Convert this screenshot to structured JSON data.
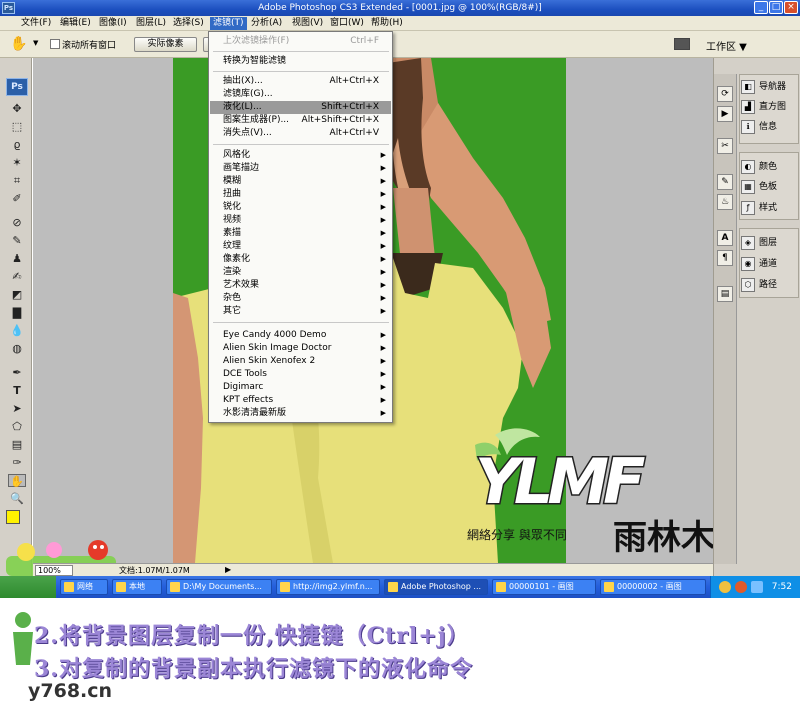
{
  "window": {
    "app_badge": "Ps",
    "title": "Adobe Photoshop CS3 Extended - [0001.jpg @ 100%(RGB/8#)]",
    "buttons": [
      "_",
      "□",
      "×"
    ]
  },
  "menubar": {
    "items": [
      "文件(F)",
      "编辑(E)",
      "图像(I)",
      "图层(L)",
      "选择(S)",
      "滤镜(T)",
      "分析(A)",
      "视图(V)",
      "窗口(W)",
      "帮助(H)"
    ],
    "active_index": 5
  },
  "options_bar": {
    "scroll_all_label": "滚动所有窗口",
    "actual_pixels_label": "实际像素",
    "workspace_label": "工作区 ▼"
  },
  "filter_menu": {
    "items": [
      {
        "label": "上次滤镜操作(F)",
        "shortcut": "Ctrl+F",
        "disabled": true
      },
      {
        "separator": true
      },
      {
        "label": "转换为智能滤镜"
      },
      {
        "separator": true
      },
      {
        "label": "抽出(X)...",
        "shortcut": "Alt+Ctrl+X"
      },
      {
        "label": "滤镜库(G)..."
      },
      {
        "label": "液化(L)...",
        "shortcut": "Shift+Ctrl+X",
        "highlighted": true
      },
      {
        "label": "图案生成器(P)...",
        "shortcut": "Alt+Shift+Ctrl+X"
      },
      {
        "label": "消失点(V)...",
        "shortcut": "Alt+Ctrl+V"
      },
      {
        "separator": true
      },
      {
        "label": "风格化",
        "submenu": true
      },
      {
        "label": "画笔描边",
        "submenu": true
      },
      {
        "label": "模糊",
        "submenu": true
      },
      {
        "label": "扭曲",
        "submenu": true
      },
      {
        "label": "锐化",
        "submenu": true
      },
      {
        "label": "视频",
        "submenu": true
      },
      {
        "label": "素描",
        "submenu": true
      },
      {
        "label": "纹理",
        "submenu": true
      },
      {
        "label": "像素化",
        "submenu": true
      },
      {
        "label": "渲染",
        "submenu": true
      },
      {
        "label": "艺术效果",
        "submenu": true
      },
      {
        "label": "杂色",
        "submenu": true
      },
      {
        "label": "其它",
        "submenu": true
      },
      {
        "separator": true
      },
      {
        "label": "Eye Candy 4000  Demo",
        "submenu": true
      },
      {
        "label": "Alien Skin Image Doctor",
        "submenu": true
      },
      {
        "label": "Alien Skin Xenofex 2",
        "submenu": true
      },
      {
        "label": "DCE Tools",
        "submenu": true
      },
      {
        "label": "Digimarc",
        "submenu": true
      },
      {
        "label": "KPT effects",
        "submenu": true
      },
      {
        "label": "水影清清最新版",
        "submenu": true
      }
    ]
  },
  "panels": {
    "group1": [
      "导航器",
      "直方图",
      "信息"
    ],
    "group2": [
      "颜色",
      "色板",
      "样式"
    ],
    "group3": [
      "图层",
      "通道",
      "路径"
    ]
  },
  "statusbar": {
    "zoom": "100%",
    "doc_info": "文档:1.07M/1.07M",
    "arrow": "▶"
  },
  "taskbar": {
    "buttons": [
      {
        "label": "网络"
      },
      {
        "label": "本地"
      },
      {
        "label": "D:\\My Documents..."
      },
      {
        "label": "http://img2.ylmf.n..."
      },
      {
        "label": "Adobe Photoshop ..."
      },
      {
        "label": "00000101 - 画图"
      },
      {
        "label": "00000002 - 画图"
      }
    ],
    "clock": "7:52"
  },
  "watermark": {
    "brand_text": "YLMF",
    "slogan": "網絡分享 與眾不同",
    "chinese_name": "雨林木风"
  },
  "caption": {
    "line1": "2.将背景图层复制一份,快捷键（Ctrl+j）",
    "line2": "3.对复制的背景副本执行滤镜下的液化命令",
    "site": "y768.cn"
  },
  "colors": {
    "canvas_green": "#3a9b25",
    "shirt_yellow": "#e7e07a",
    "menu_highlight": "#9a9a9a",
    "caption_purple": "#9b86d6"
  }
}
